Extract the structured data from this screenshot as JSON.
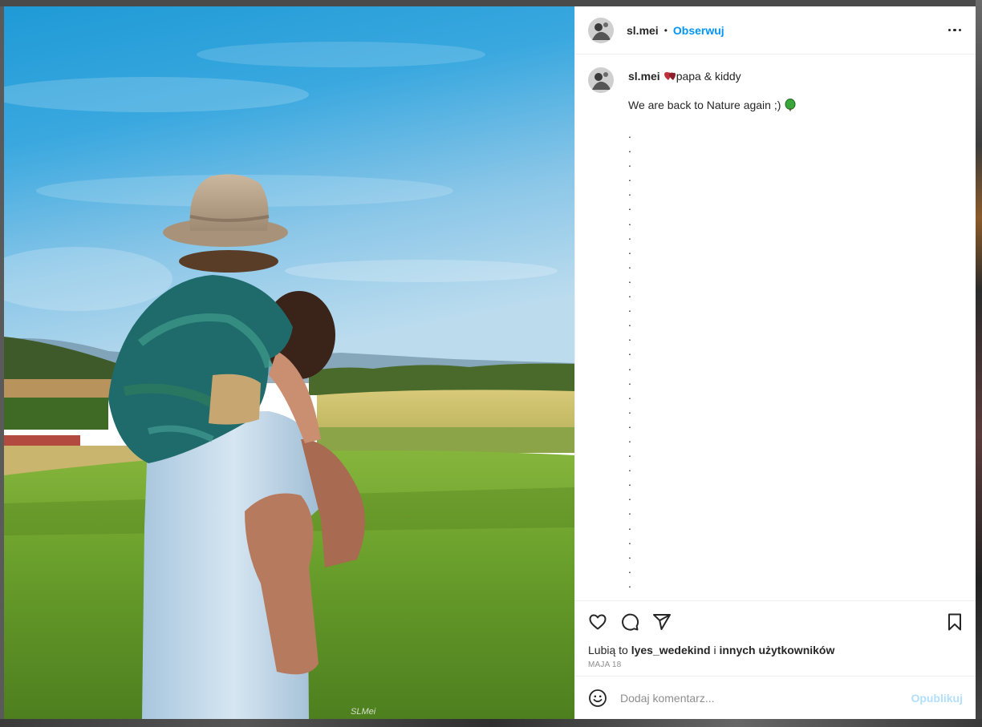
{
  "post": {
    "username": "sl.mei",
    "follow_label": "Obserwuj",
    "separator": "•",
    "caption_user": "sl.mei",
    "caption_text": "papa & kiddy",
    "caption_line2": "We are back to Nature again ;)",
    "caption_dots": ".\n.\n.\n.\n.\n.\n.\n.\n.\n.\n.\n.\n.\n.\n.\n.\n.\n.\n.\n.\n.\n.\n.\n.\n.\n.\n.\n.\n.\n.\n.\n.\n.",
    "photo_watermark": "SLMei"
  },
  "likes": {
    "prefix": "Lubią to",
    "user": "lyes_wedekind",
    "joiner": "i",
    "others": "innych użytkowników"
  },
  "date": "MAJA 18",
  "comment": {
    "placeholder": "Dodaj komentarz...",
    "publish_label": "Opublikuj"
  },
  "icons": {
    "more": "more-options-icon",
    "like": "heart-icon",
    "comment": "comment-icon",
    "share": "share-icon",
    "save": "bookmark-icon",
    "emoji": "emoji-icon"
  },
  "colors": {
    "accent": "#0095f6",
    "publish_disabled": "#b2dffc",
    "meta_gray": "#8e8e8e"
  }
}
